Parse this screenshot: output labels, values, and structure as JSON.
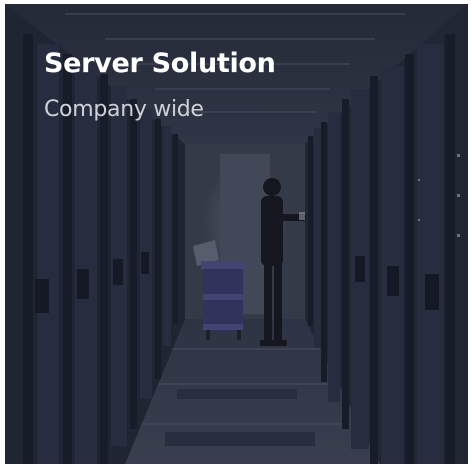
{
  "card": {
    "title": "Server Solution",
    "subtitle": "Company wide",
    "image_subject": "server-room-photo",
    "colors": {
      "overlay": "#1d2130",
      "title": "#ffffff",
      "subtitle": "#cfd1d8"
    }
  }
}
